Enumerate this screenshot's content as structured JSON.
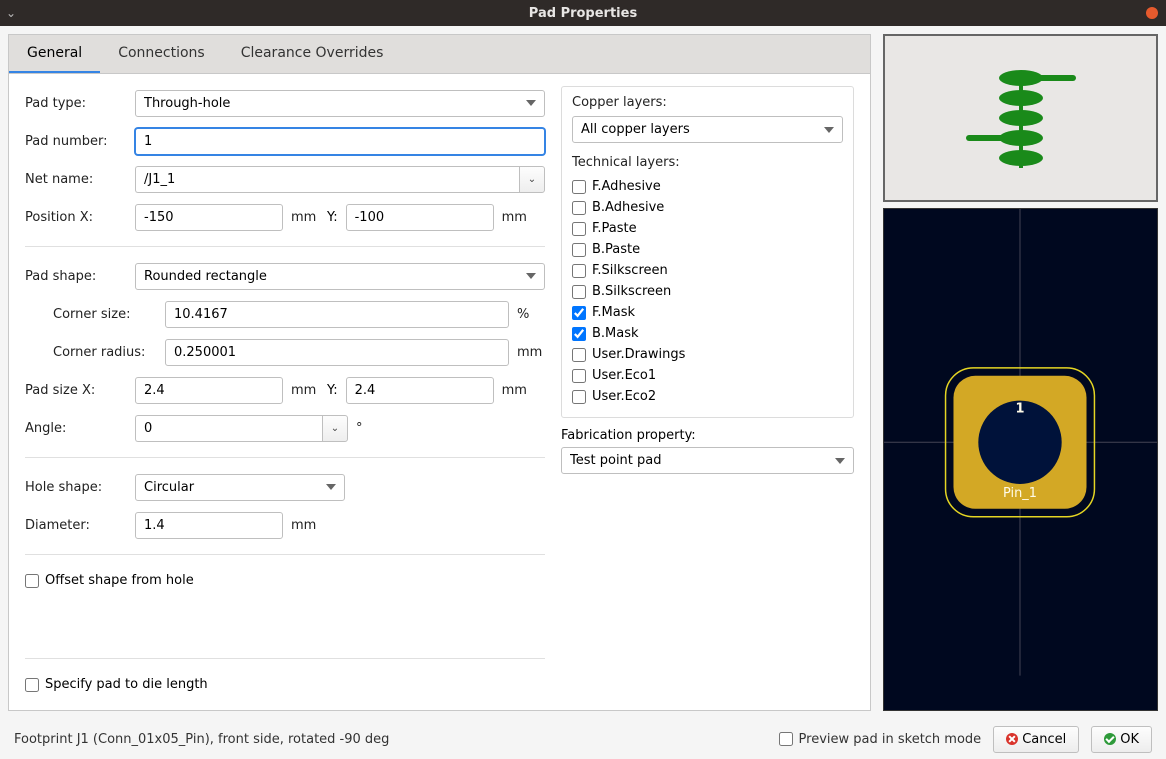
{
  "window": {
    "title": "Pad Properties"
  },
  "tabs": [
    "General",
    "Connections",
    "Clearance Overrides"
  ],
  "pad_type": {
    "label": "Pad type:",
    "value": "Through-hole"
  },
  "pad_number": {
    "label": "Pad number:",
    "value": "1"
  },
  "net_name": {
    "label": "Net name:",
    "value": "/J1_1"
  },
  "position": {
    "label": "Position X:",
    "x": "-150",
    "y_label": "Y:",
    "y": "-100",
    "unit": "mm"
  },
  "pad_shape": {
    "label": "Pad shape:",
    "value": "Rounded rectangle"
  },
  "corner_size": {
    "label": "Corner size:",
    "value": "10.4167",
    "unit": "%"
  },
  "corner_radius": {
    "label": "Corner radius:",
    "value": "0.250001",
    "unit": "mm"
  },
  "pad_size": {
    "label": "Pad size X:",
    "x": "2.4",
    "y_label": "Y:",
    "y": "2.4",
    "unit": "mm"
  },
  "angle": {
    "label": "Angle:",
    "value": "0",
    "unit": "°"
  },
  "hole_shape": {
    "label": "Hole shape:",
    "value": "Circular"
  },
  "diameter": {
    "label": "Diameter:",
    "value": "1.4",
    "unit": "mm"
  },
  "offset_shape": {
    "label": "Offset shape from hole",
    "checked": false
  },
  "specify_die": {
    "label": "Specify pad to die length",
    "checked": false
  },
  "copper_layers": {
    "label": "Copper layers:",
    "value": "All copper layers"
  },
  "tech_layers": {
    "label": "Technical layers:",
    "items": [
      {
        "name": "F.Adhesive",
        "checked": false
      },
      {
        "name": "B.Adhesive",
        "checked": false
      },
      {
        "name": "F.Paste",
        "checked": false
      },
      {
        "name": "B.Paste",
        "checked": false
      },
      {
        "name": "F.Silkscreen",
        "checked": false
      },
      {
        "name": "B.Silkscreen",
        "checked": false
      },
      {
        "name": "F.Mask",
        "checked": true
      },
      {
        "name": "B.Mask",
        "checked": true
      },
      {
        "name": "User.Drawings",
        "checked": false
      },
      {
        "name": "User.Eco1",
        "checked": false
      },
      {
        "name": "User.Eco2",
        "checked": false
      }
    ]
  },
  "fab_property": {
    "label": "Fabrication property:",
    "value": "Test point pad"
  },
  "footer": {
    "info": "Footprint J1 (Conn_01x05_Pin), front side, rotated -90 deg",
    "preview_label": "Preview pad in sketch mode",
    "cancel": "Cancel",
    "ok": "OK"
  },
  "preview": {
    "pad_label": "1",
    "pin_label": "Pin_1",
    "pad_color": "#d3a825",
    "hole_color": "#00123a",
    "outline_color": "#e4d523"
  }
}
